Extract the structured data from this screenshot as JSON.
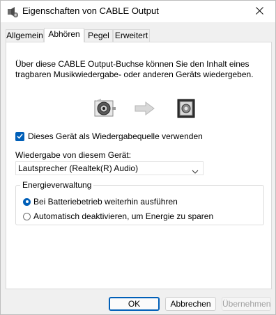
{
  "window": {
    "title": "Eigenschaften von CABLE Output"
  },
  "icons": {
    "title": "speaker-settings-icon",
    "close": "close-icon",
    "source_device": "cable-device-icon",
    "arrow": "arrow-right-icon",
    "target_device": "speaker-device-icon",
    "select_arrow": "chevron-down-icon"
  },
  "tabs": [
    {
      "label": "Allgemein",
      "active": false
    },
    {
      "label": "Abhören",
      "active": true
    },
    {
      "label": "Pegel",
      "active": false
    },
    {
      "label": "Erweitert",
      "active": false
    }
  ],
  "listen": {
    "description": "Über diese CABLE Output-Buchse können Sie den Inhalt eines tragbaren Musikwiedergabe- oder anderen Geräts wiedergeben.",
    "checkbox_label": "Dieses Gerät als Wiedergabequelle verwenden",
    "checkbox_checked": true,
    "playback_label": "Wiedergabe von diesem Gerät:",
    "playback_device": "Lautsprecher (Realtek(R) Audio)"
  },
  "power": {
    "group_label": "Energieverwaltung",
    "options": [
      {
        "label": "Bei Batteriebetrieb weiterhin ausführen",
        "selected": true
      },
      {
        "label": "Automatisch deaktivieren, um Energie zu sparen",
        "selected": false
      }
    ]
  },
  "buttons": {
    "ok": "OK",
    "cancel": "Abbrechen",
    "apply": "Übernehmen"
  },
  "colors": {
    "accent": "#005fb8",
    "panel": "#ffffff",
    "window": "#f0f0f0",
    "disabled_text": "#a0a0a0"
  }
}
